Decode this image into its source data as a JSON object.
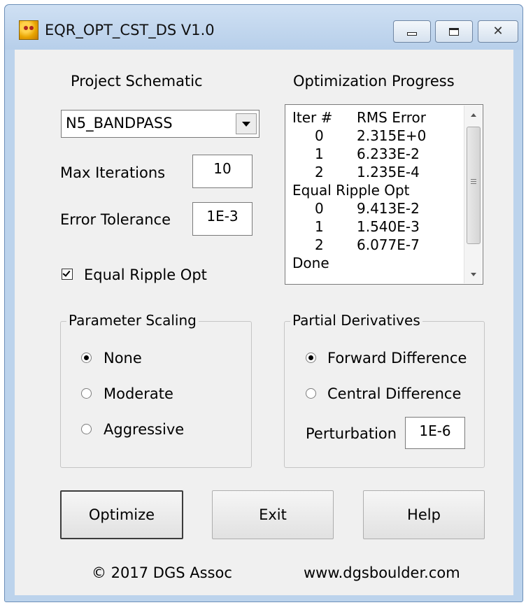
{
  "window": {
    "title": "EQR_OPT_CST_DS  V1.0"
  },
  "left": {
    "schematic_label": "Project Schematic",
    "schematic_value": "N5_BANDPASS",
    "max_iter_label": "Max Iterations",
    "max_iter_value": "10",
    "error_tol_label": "Error Tolerance",
    "error_tol_value": "1E-3",
    "equal_ripple_label": "Equal Ripple Opt",
    "equal_ripple_checked": true
  },
  "progress": {
    "label": "Optimization Progress",
    "header": [
      "Iter #",
      "RMS Error"
    ],
    "rows": [
      [
        "0",
        "2.315E+0"
      ],
      [
        "1",
        "6.233E-2"
      ],
      [
        "2",
        "1.235E-4"
      ]
    ],
    "section2": "Equal Ripple Opt",
    "rows2": [
      [
        "0",
        "9.413E-2"
      ],
      [
        "1",
        "1.540E-3"
      ],
      [
        "2",
        "6.077E-7"
      ]
    ],
    "done": "Done"
  },
  "scaling": {
    "title": "Parameter Scaling",
    "options": [
      "None",
      "Moderate",
      "Aggressive"
    ],
    "selected": "None"
  },
  "derivatives": {
    "title": "Partial Derivatives",
    "options": [
      "Forward Difference",
      "Central Difference"
    ],
    "selected": "Forward Difference",
    "perturbation_label": "Perturbation",
    "perturbation_value": "1E-6"
  },
  "buttons": {
    "optimize": "Optimize",
    "exit": "Exit",
    "help": "Help"
  },
  "footer": {
    "copyright": "© 2017 DGS Assoc",
    "website": "www.dgsboulder.com"
  }
}
